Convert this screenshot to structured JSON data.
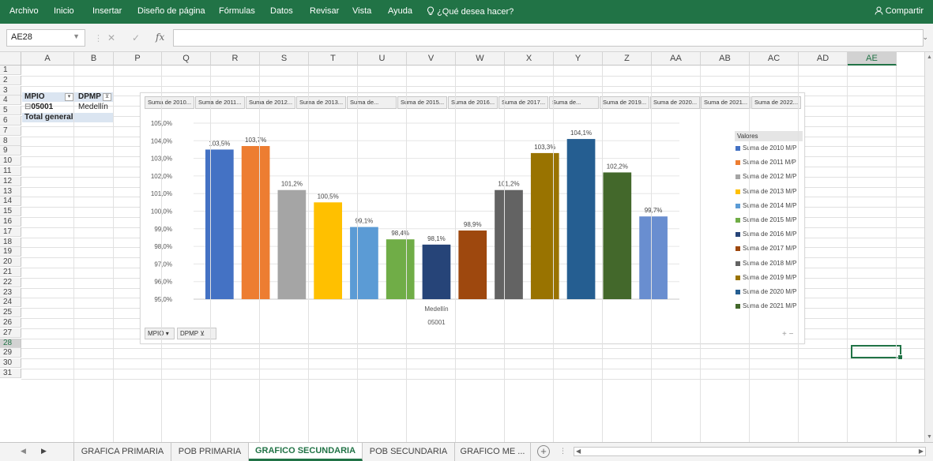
{
  "ribbon": {
    "tabs": [
      "Archivo",
      "Inicio",
      "Insertar",
      "Diseño de página",
      "Fórmulas",
      "Datos",
      "Revisar",
      "Vista",
      "Ayuda"
    ],
    "tell_me": "¿Qué desea hacer?",
    "share": "Compartir"
  },
  "formula_bar": {
    "name_box": "AE28",
    "fx": "fx",
    "formula": ""
  },
  "columns": [
    "A",
    "B",
    "P",
    "Q",
    "R",
    "S",
    "T",
    "U",
    "V",
    "W",
    "X",
    "Y",
    "Z",
    "AA",
    "AB",
    "AC",
    "AD",
    "AE"
  ],
  "rows": [
    "1",
    "2",
    "3",
    "4",
    "5",
    "6",
    "7",
    "8",
    "9",
    "10",
    "11",
    "12",
    "13",
    "14",
    "15",
    "16",
    "17",
    "18",
    "19",
    "20",
    "21",
    "22",
    "23",
    "24",
    "25",
    "26",
    "27",
    "28",
    "29",
    "30",
    "31"
  ],
  "pivot": {
    "header_mpio": "MPIO",
    "header_dpmp": "DPMP",
    "row_code": "05001",
    "row_name": "Medellín",
    "total": "Total general"
  },
  "chart": {
    "field_buttons": [
      "Suma de 2010...",
      "Suma de 2011...",
      "Suma de 2012...",
      "Suma de 2013...",
      "Suma de...",
      "Suma de 2015...",
      "Suma de 2016...",
      "Suma de 2017...",
      "Suma de...",
      "Suma de 2019...",
      "Suma de 2020...",
      "Suma de 2021...",
      "Suma de 2022..."
    ],
    "axis_buttons": [
      "MPIO",
      "DPMP"
    ],
    "legend_title": "Valores",
    "zoom": "+ −"
  },
  "chart_data": {
    "type": "bar",
    "categories": [
      "Medellín"
    ],
    "category_code": "05001",
    "y_ticks": [
      "105,0%",
      "104,0%",
      "103,0%",
      "102,0%",
      "101,0%",
      "100,0%",
      "99,0%",
      "98,0%",
      "97,0%",
      "96,0%",
      "95,0%"
    ],
    "ylim": [
      95,
      105
    ],
    "series": [
      {
        "name": "Suma de 2010 M/P",
        "values": [
          103.5
        ],
        "label": "103,5%",
        "color": "#4472C4"
      },
      {
        "name": "Suma de 2011 M/P",
        "values": [
          103.7
        ],
        "label": "103,7%",
        "color": "#ED7D31"
      },
      {
        "name": "Suma de 2012 M/P",
        "values": [
          101.2
        ],
        "label": "101,2%",
        "color": "#A5A5A5"
      },
      {
        "name": "Suma de 2013 M/P",
        "values": [
          100.5
        ],
        "label": "100,5%",
        "color": "#FFC000"
      },
      {
        "name": "Suma de 2014 M/P",
        "values": [
          99.1
        ],
        "label": "99,1%",
        "color": "#5B9BD5"
      },
      {
        "name": "Suma de 2015 M/P",
        "values": [
          98.4
        ],
        "label": "98,4%",
        "color": "#70AD47"
      },
      {
        "name": "Suma de 2016 M/P",
        "values": [
          98.1
        ],
        "label": "98,1%",
        "color": "#264478"
      },
      {
        "name": "Suma de 2017 M/P",
        "values": [
          98.9
        ],
        "label": "98,9%",
        "color": "#9E480E"
      },
      {
        "name": "Suma de 2018 M/P",
        "values": [
          101.2
        ],
        "label": "101,2%",
        "color": "#636363"
      },
      {
        "name": "Suma de 2019 M/P",
        "values": [
          103.3
        ],
        "label": "103,3%",
        "color": "#997300"
      },
      {
        "name": "Suma de 2020 M/P",
        "values": [
          104.1
        ],
        "label": "104,1%",
        "color": "#255E91"
      },
      {
        "name": "Suma de 2021 M/P",
        "values": [
          102.2
        ],
        "label": "102,2%",
        "color": "#43682B"
      },
      {
        "name": "",
        "values": [
          99.7
        ],
        "label": "99,7%",
        "color": "#698ED0"
      }
    ]
  },
  "sheet_tabs": [
    "GRAFICA PRIMARIA",
    "POB PRIMARIA",
    "GRAFICO SECUNDARIA",
    "POB SECUNDARIA",
    "GRAFICO ME ..."
  ],
  "active_sheet": "GRAFICO SECUNDARIA",
  "colors": {
    "excel_green": "#217346"
  }
}
